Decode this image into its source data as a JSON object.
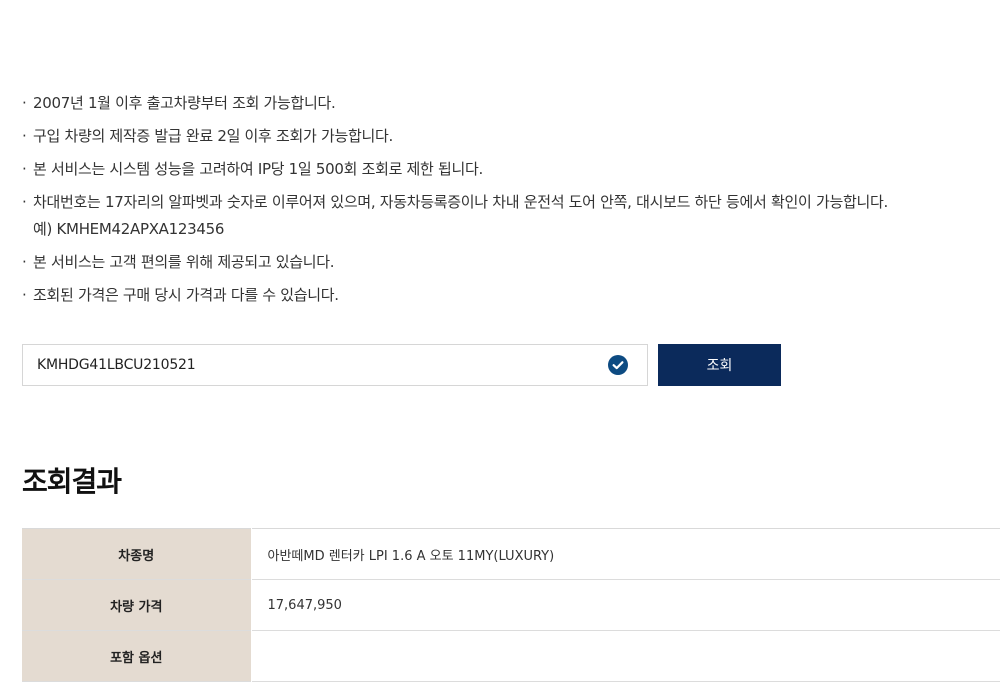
{
  "notices": [
    "2007년 1월 이후 출고차량부터 조회 가능합니다.",
    "구입 차량의 제작증 발급 완료 2일 이후 조회가 가능합니다.",
    "본 서비스는 시스템 성능을 고려하여 IP당 1일 500회 조회로 제한 됩니다.",
    "차대번호는 17자리의 알파벳과 숫자로 이루어져 있으며, 자동차등록증이나 차내 운전석 도어 안쪽, 대시보드 하단 등에서 확인이 가능합니다.",
    "본 서비스는 고객 편의를 위해 제공되고 있습니다.",
    "조회된 가격은 구매 당시 가격과 다를 수 있습니다."
  ],
  "notice_bullet": "·",
  "notice_example": "예) KMHEM42APXA123456",
  "search": {
    "vin_value": "KMHDG41LBCU210521",
    "button_label": "조회",
    "valid_icon": "check-circle-icon",
    "accent_color": "#0b2a5b"
  },
  "result": {
    "title": "조회결과",
    "rows": [
      {
        "label": "차종명",
        "value": "아반떼MD 렌터카 LPI 1.6 A 오토 11MY(LUXURY)"
      },
      {
        "label": "차량 가격",
        "value": "17,647,950"
      },
      {
        "label": "포함 옵션",
        "value": ""
      }
    ]
  }
}
